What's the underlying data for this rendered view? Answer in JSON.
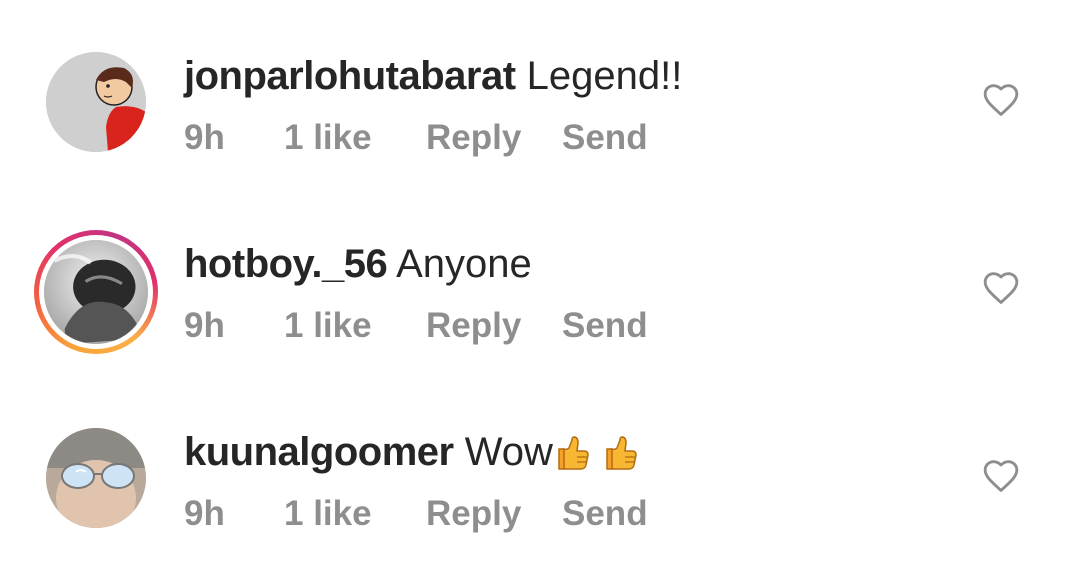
{
  "comments": [
    {
      "username": "jonparlohutabarat",
      "text": "Legend!!",
      "time": "9h",
      "likes": "1 like",
      "reply_label": "Reply",
      "send_label": "Send",
      "has_story_ring": false,
      "like_icon": "heart-outline-icon"
    },
    {
      "username": "hotboy._56",
      "text": "Anyone",
      "time": "9h",
      "likes": "1 like",
      "reply_label": "Reply",
      "send_label": "Send",
      "has_story_ring": true,
      "like_icon": "heart-outline-icon"
    },
    {
      "username": "kuunalgoomer",
      "text": "Wow",
      "emojis": [
        "thumbs-up-emoji",
        "thumbs-up-emoji"
      ],
      "time": "9h",
      "likes": "1 like",
      "reply_label": "Reply",
      "send_label": "Send",
      "has_story_ring": false,
      "like_icon": "heart-outline-icon"
    }
  ],
  "colors": {
    "username": "#262626",
    "meta": "#8e8e8e",
    "heart_outline": "#8e8e8e",
    "story_ring_gradient": [
      "#fcaf45",
      "#f56040",
      "#e1306c",
      "#c13584"
    ]
  }
}
